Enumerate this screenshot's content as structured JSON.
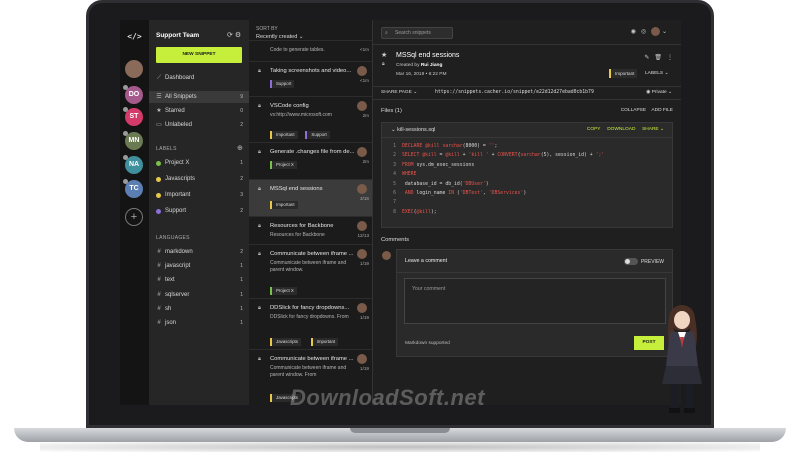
{
  "rail": {
    "logo": "</>",
    "avatars": [
      {
        "initials": "",
        "color": "#8a6a58"
      },
      {
        "initials": "DO",
        "color": "#a55a8c"
      },
      {
        "initials": "ST",
        "color": "#d43b6a"
      },
      {
        "initials": "MN",
        "color": "#6a7a52"
      },
      {
        "initials": "NA",
        "color": "#3f8f9c"
      },
      {
        "initials": "TC",
        "color": "#5b7fb3"
      }
    ],
    "add": "+"
  },
  "sidebar": {
    "team_name": "Support Team",
    "new_snippet": "NEW SNIPPET",
    "dashboard": "Dashboard",
    "nav": [
      {
        "label": "All Snippets",
        "count": "9",
        "icon": "☰"
      },
      {
        "label": "Starred",
        "count": "0",
        "icon": "★"
      },
      {
        "label": "Unlabeled",
        "count": "2",
        "icon": "▭"
      }
    ],
    "labels_heading": "LABELS",
    "labels": [
      {
        "label": "Project X",
        "count": "1",
        "color": "#7ac04a"
      },
      {
        "label": "Javascripts",
        "count": "2",
        "color": "#e8c84a"
      },
      {
        "label": "Important",
        "count": "3",
        "color": "#e8c84a"
      },
      {
        "label": "Support",
        "count": "2",
        "color": "#8e6fd8"
      }
    ],
    "languages_heading": "LANGUAGES",
    "languages": [
      {
        "label": "markdown",
        "count": "2"
      },
      {
        "label": "javascript",
        "count": "1"
      },
      {
        "label": "text",
        "count": "1"
      },
      {
        "label": "sqlserver",
        "count": "1"
      },
      {
        "label": "sh",
        "count": "1"
      },
      {
        "label": "json",
        "count": "1"
      }
    ]
  },
  "list": {
    "sort_label": "SORT BY",
    "sort_value": "Recently created",
    "items": [
      {
        "title": "",
        "desc": "Code to generate tables.",
        "meta": "<1m",
        "tags": []
      },
      {
        "title": "Taking screenshots and video...",
        "desc": "",
        "meta": "<1m",
        "tags": [
          {
            "label": "Support",
            "color": "#8e6fd8"
          }
        ]
      },
      {
        "title": "VSCode config",
        "desc": "vs:http://www.microsoft.com",
        "meta": "2m",
        "tags": [
          {
            "label": "Important",
            "color": "#e8c84a"
          },
          {
            "label": "Support",
            "color": "#8e6fd8"
          }
        ]
      },
      {
        "title": "Generate .changes file from de...",
        "desc": "",
        "meta": "2m",
        "tags": [
          {
            "label": "Project X",
            "color": "#7ac04a"
          }
        ]
      },
      {
        "title": "MSSql end sessions",
        "desc": "",
        "meta": "3/16",
        "tags": [
          {
            "label": "Important",
            "color": "#e8c84a"
          }
        ]
      },
      {
        "title": "Resources for Backbone",
        "desc": "Resources for Backbone",
        "meta": "12/13",
        "tags": []
      },
      {
        "title": "Communicate between iframe ...",
        "desc": "Communicate between iframe and parent window.",
        "meta": "1/19",
        "tags": [
          {
            "label": "Project X",
            "color": "#7ac04a"
          }
        ]
      },
      {
        "title": "DDSlick for fancy dropdowns...",
        "desc": "DDSlick for fancy dropdowns. From",
        "meta": "1/19",
        "tags": [
          {
            "label": "Javascripts",
            "color": "#e8c84a"
          },
          {
            "label": "Important",
            "color": "#e8c84a"
          }
        ]
      },
      {
        "title": "Communicate between iframe ...",
        "desc": "Communicate between iframe and parent window. From",
        "meta": "1/19",
        "tags": [
          {
            "label": "Javascripts",
            "color": "#e8c84a"
          }
        ]
      }
    ]
  },
  "main": {
    "search_placeholder": "Search snippets",
    "private": "Private",
    "title": "MSSql end sessions",
    "created_prefix": "Created by",
    "author": "Rui Jiang",
    "date": "Mar 16, 2018 • 6:22 PM",
    "tag": "Important",
    "labels_btn": "LABELS",
    "share_page": "SHARE PAGE",
    "url": "https://snippets.cacher.io/snippet/e22d12d27ebad0cb1b79",
    "files": "Files (1)",
    "collapse": "COLLAPSE",
    "add_file": "ADD FILE",
    "filename": "kill-sessions.sql",
    "copy": "COPY",
    "download": "DOWNLOAD",
    "share": "SHARE",
    "code": [
      {
        "n": "1",
        "text": "DECLARE @kill varchar(8000) = '';"
      },
      {
        "n": "2",
        "text": "SELECT @kill = @kill + 'kill ' + CONVERT(varchar(5), session_id) + ';'"
      },
      {
        "n": "3",
        "text": "FROM sys.dm_exec_sessions"
      },
      {
        "n": "4",
        "text": "WHERE"
      },
      {
        "n": "5",
        "text": "        database_id  = db_id('DBUser')"
      },
      {
        "n": "6",
        "text": "        AND login_name IN ('DBTest', 'DBServices')"
      },
      {
        "n": "7",
        "text": ""
      },
      {
        "n": "8",
        "text": "EXEC(@kill);"
      }
    ],
    "comments": "Comments",
    "leave_comment": "Leave a comment",
    "preview": "PREVIEW",
    "comment_placeholder": "Your comment",
    "markdown": "Markdown supported",
    "post": "POST"
  },
  "watermark": "DownloadSoft.net",
  "colors": {
    "accent": "#c6ef3c",
    "code_keyword": "#e9524a"
  }
}
